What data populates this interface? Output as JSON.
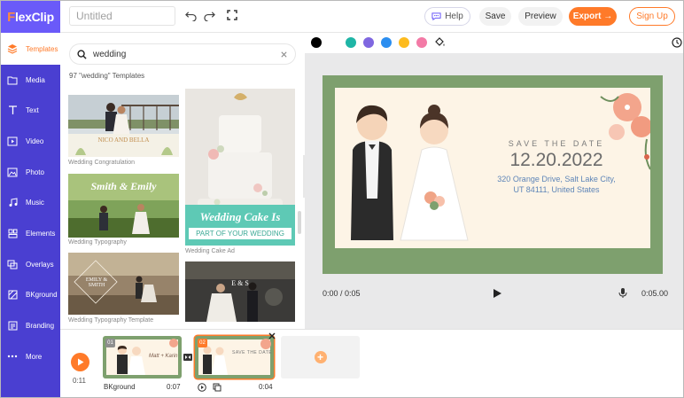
{
  "app": {
    "logo_text": "lexClip",
    "logo_mark": "F",
    "title_placeholder": "Untitled"
  },
  "toolbar": {
    "help_label": "Help",
    "save_label": "Save",
    "preview_label": "Preview",
    "export_label": "Export →",
    "signup_label": "Sign Up"
  },
  "sidebar": {
    "items": [
      {
        "label": "Templates",
        "icon": "templates-icon"
      },
      {
        "label": "Media",
        "icon": "folder-icon"
      },
      {
        "label": "Text",
        "icon": "text-icon"
      },
      {
        "label": "Video",
        "icon": "video-icon"
      },
      {
        "label": "Photo",
        "icon": "photo-icon"
      },
      {
        "label": "Music",
        "icon": "music-icon"
      },
      {
        "label": "Elements",
        "icon": "elements-icon"
      },
      {
        "label": "Overlays",
        "icon": "overlays-icon"
      },
      {
        "label": "BKground",
        "icon": "background-icon"
      },
      {
        "label": "Branding",
        "icon": "branding-icon"
      },
      {
        "label": "More",
        "icon": "more-icon"
      }
    ]
  },
  "templates_panel": {
    "search_value": "wedding",
    "result_count": "97 \"wedding\" Templates",
    "templates": [
      {
        "label": "Wedding Congratulation",
        "overlay_text": "NICO AND BELLA"
      },
      {
        "label": "Wedding Typography",
        "overlay_text": "Smith & Emily"
      },
      {
        "label": "Wedding Typography Template",
        "overlay_text": "EMILY & SMITH"
      },
      {
        "label": "Wedding Cake Ad",
        "overlay_title": "Wedding Cake Is",
        "overlay_sub": "PART OF YOUR WEDDING"
      },
      {
        "label": "",
        "overlay_text": "E & S"
      }
    ]
  },
  "colors": {
    "swatches": [
      "#000000",
      "#ffffff",
      "#1fb5a6",
      "#7f67e0",
      "#2b8ef0",
      "#fdbb1e",
      "#f37aa6"
    ],
    "accent": "#ff7a29",
    "nav": "#4a3fd1"
  },
  "canvas": {
    "headline": "SAVE THE DATE",
    "date": "12.20.2022",
    "address_line1": "320 Orange Drive, Salt Lake City,",
    "address_line2": "UT 84111, United States"
  },
  "playback": {
    "current": "0:00 / 0:05",
    "total": "0:05.00"
  },
  "timeline": {
    "total_time": "0:11",
    "clips": [
      {
        "num": "01",
        "label": "BKground",
        "duration": "0:07",
        "card_text": "Matt + Karin"
      },
      {
        "num": "02",
        "label": "",
        "duration": "0:04",
        "card_text": "SAVE THE DATE"
      }
    ],
    "add_label": "+"
  }
}
